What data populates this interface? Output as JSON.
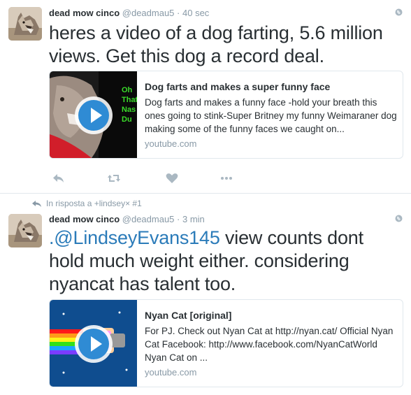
{
  "tweets": [
    {
      "author": {
        "name": "dead mow cinco",
        "handle": "@deadmau5"
      },
      "separator": "·",
      "time": "40 sec",
      "text": "heres a video of a dog farting, 5.6 million views. Get this dog a record deal.",
      "card": {
        "title": "Dog farts and makes a super funny face",
        "description": "Dog farts and makes a funny face -hold your breath this ones going to stink-Super Britney my funny Weimaraner dog making some of the funny faces we caught on...",
        "domain": "youtube.com",
        "thumb_text": [
          "Oh",
          "That",
          "Nas",
          "Du"
        ]
      },
      "actions": [
        "reply-icon",
        "retweet-icon",
        "like-icon",
        "more-icon"
      ]
    },
    {
      "reply_context": "In risposta a +lindsey× #1",
      "author": {
        "name": "dead mow cinco",
        "handle": "@deadmau5"
      },
      "separator": "·",
      "time": "3 min",
      "mention": ".@LindseyEvans145",
      "text_rest": " view counts dont hold much weight either. considering nyancat has talent too.",
      "card": {
        "title": "Nyan Cat [original]",
        "description": "For PJ. Check out Nyan Cat at http://nyan.cat/ Official Nyan Cat Facebook: http://www.facebook.com/NyanCatWorld Nyan Cat on ...",
        "domain": "youtube.com"
      }
    }
  ],
  "colors": {
    "text": "#292f33",
    "muted": "#8899a6",
    "link": "#2b7bb9",
    "border": "#e1e8ed",
    "play": "#2f8bd4",
    "nyan_bg": "#0f4d8f"
  }
}
